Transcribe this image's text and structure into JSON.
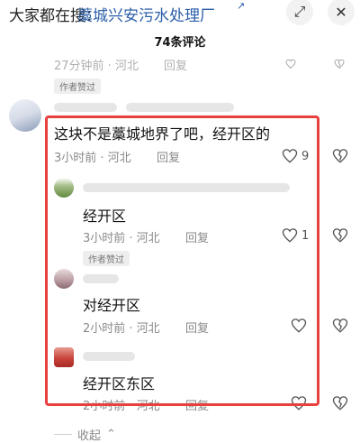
{
  "header": {
    "search_prefix": "大家都在搜：",
    "search_keyword": "藁城兴安污水处理厂",
    "search_arrow": "↗",
    "expand_glyph": "⤢",
    "close_glyph": "✕",
    "comment_count": "74条评论"
  },
  "prev_comment": {
    "time": "27分钟前 · 河北",
    "reply": "回复"
  },
  "author_liked_badge": "作者赞过",
  "main_comment": {
    "text": "这块不是藁城地界了吧，经开区的",
    "time": "3小时前 · 河北",
    "reply": "回复",
    "likes": "9"
  },
  "replies": [
    {
      "text": "经开区",
      "time": "3小时前 · 河北",
      "reply": "回复",
      "likes": "1",
      "badge": "",
      "avatar_color": "#7a9a52"
    },
    {
      "text": "对经开区",
      "time": "2小时前 · 河北",
      "reply": "回复",
      "likes": "",
      "badge": "作者赞过",
      "avatar_color": "#b89aa0"
    },
    {
      "text": "经开区东区",
      "time": "2小时前 · 河北",
      "reply": "回复",
      "likes": "",
      "badge": "",
      "avatar_color": "#c8443c"
    }
  ],
  "collapse_label": "收起",
  "collapse_glyph": "⌃",
  "icons": {
    "like": "heart-outline-icon",
    "dislike": "broken-heart-icon",
    "expand": "expand-icon",
    "close": "close-icon"
  },
  "colors": {
    "highlight": "#e8403f",
    "search_keyword": "#2b5ea8"
  }
}
